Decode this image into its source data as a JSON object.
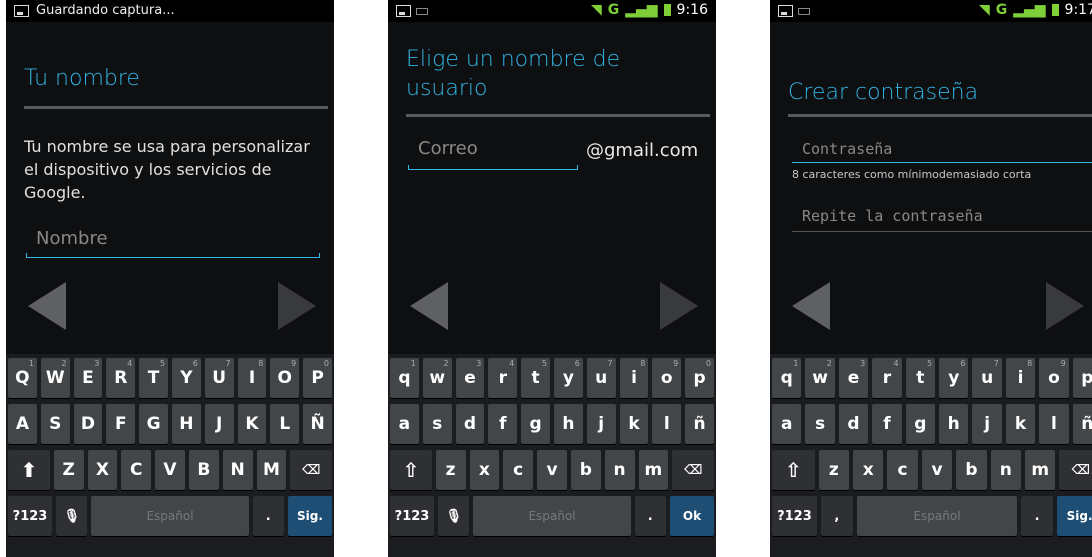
{
  "screens": [
    {
      "status_text": "Guardando captura...",
      "title": "Tu nombre",
      "description": "Tu nombre se usa para personalizar el dispositivo y los servicios de Google.",
      "name_placeholder": "Nombre",
      "keyboard": {
        "row1": [
          "Q",
          "W",
          "E",
          "R",
          "T",
          "Y",
          "U",
          "I",
          "O",
          "P"
        ],
        "row2": [
          "A",
          "S",
          "D",
          "F",
          "G",
          "H",
          "J",
          "K",
          "L",
          "Ñ"
        ],
        "row3": [
          "Z",
          "X",
          "C",
          "V",
          "B",
          "N",
          "M"
        ],
        "sym": "?123",
        "space": "Español",
        "period": ".",
        "action": "Sig."
      }
    },
    {
      "time": "9:16",
      "network": "G",
      "title": "Elige un nombre de usuario",
      "email_placeholder": "Correo",
      "email_suffix": "@gmail.com",
      "keyboard": {
        "row1": [
          "q",
          "w",
          "e",
          "r",
          "t",
          "y",
          "u",
          "i",
          "o",
          "p"
        ],
        "row2": [
          "a",
          "s",
          "d",
          "f",
          "g",
          "h",
          "j",
          "k",
          "l",
          "ñ"
        ],
        "row3": [
          "z",
          "x",
          "c",
          "v",
          "b",
          "n",
          "m"
        ],
        "sym": "?123",
        "space": "Español",
        "period": ".",
        "action": "Ok"
      }
    },
    {
      "time": "9:17",
      "network": "G",
      "title": "Crear contraseña",
      "password_placeholder": "Contraseña",
      "password_hint": "8 caracteres como mínimodemasiado corta",
      "repeat_placeholder": "Repite la contraseña",
      "keyboard": {
        "row1": [
          "q",
          "w",
          "e",
          "r",
          "t",
          "y",
          "u",
          "i",
          "o",
          "p"
        ],
        "row2": [
          "a",
          "s",
          "d",
          "f",
          "g",
          "h",
          "j",
          "k",
          "l",
          "ñ"
        ],
        "row3": [
          "z",
          "x",
          "c",
          "v",
          "b",
          "n",
          "m"
        ],
        "sym": "?123",
        "comma": ",",
        "space": "Español",
        "period": ".",
        "action": "Sig."
      }
    }
  ],
  "number_hints": [
    "1",
    "2",
    "3",
    "4",
    "5",
    "6",
    "7",
    "8",
    "9",
    "0"
  ],
  "colors": {
    "accent": "#33b5e5",
    "signal": "#7fcf38",
    "background": "#0e0f11",
    "key": "#434649",
    "action_key": "#1f4e74"
  }
}
